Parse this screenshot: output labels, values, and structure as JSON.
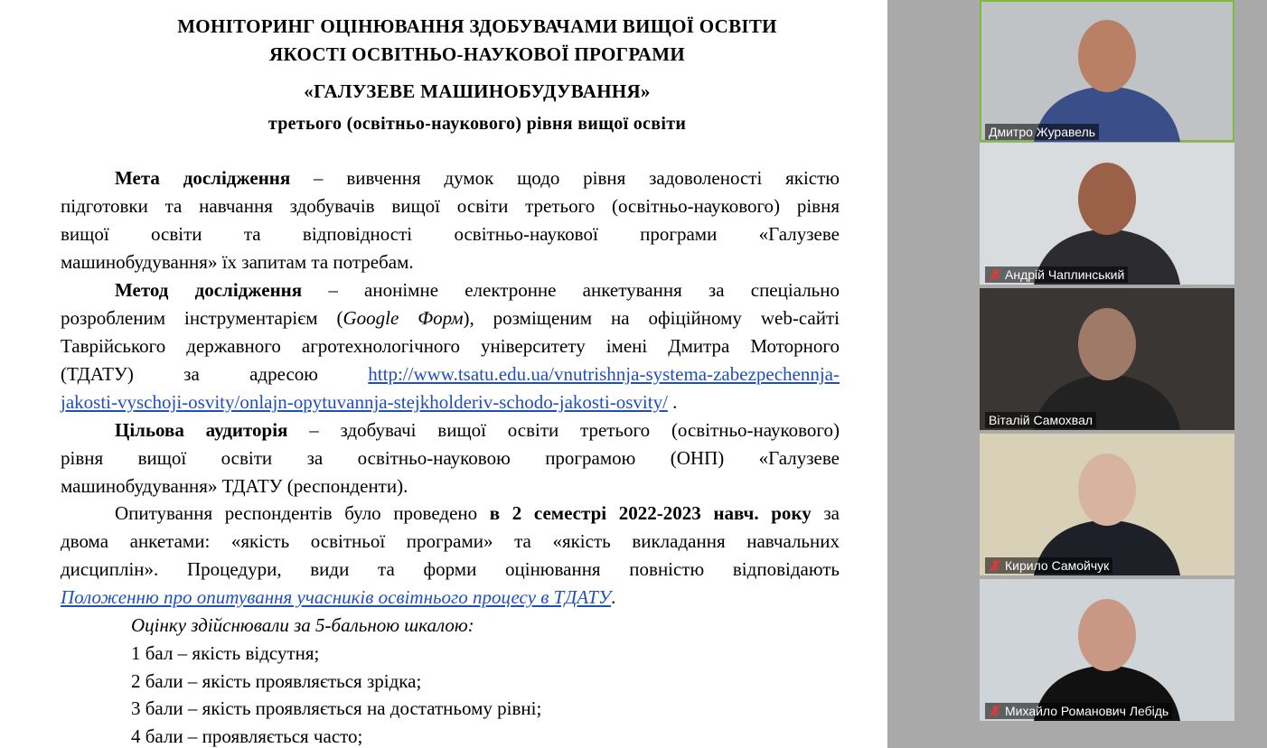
{
  "document": {
    "title_lines": [
      "МОНІТОРИНГ ОЦІНЮВАННЯ ЗДОБУВАЧАМИ ВИЩОЇ ОСВІТИ",
      "ЯКОСТІ ОСВІТНЬО-НАУКОВОЇ ПРОГРАМИ",
      "«ГАЛУЗЕВЕ МАШИНОБУДУВАННЯ»",
      "третього (освітньо-наукового)  рівня  вищої освіти"
    ],
    "goal": {
      "label": "Мета дослідження",
      "l1": " – вивчення думок щодо рівня задоволеності якістю",
      "l2": "підготовки та навчання здобувачів вищої освіти третього (освітньо-наукового) рівня",
      "l3": "вищої освіти та відповідності освітньо-наукової програми «Галузеве",
      "l4": "машинобудування» їх запитам та потребам."
    },
    "method": {
      "label": "Метод дослідження",
      "l1": " – анонімне електронне анкетування за спеціально",
      "l2a": "розробленим інструментарієм (",
      "l2b": "Google Форм",
      "l2c": "), розміщеним на офіційному web-сайті",
      "l3": "Таврійського державного агротехнологічного університету імені Дмитра Моторного",
      "l4a": "(ТДАТУ) за адресою ",
      "link1": "http://www.tsatu.edu.ua/vnutrishnja-systema-zabezpechennja-",
      "link2": "jakosti-vyschoji-osvity/onlajn-opytuvannja-stejkholderiv-schodo-jakosti-osvity/",
      "l5end": " ."
    },
    "audience": {
      "label": "Цільова аудиторія",
      "l1": " – здобувачі вищої освіти третього (освітньо-наукового)",
      "l2": "рівня вищої освіти за  освітньо-науковою програмою (ОНП) «Галузеве",
      "l3": "машинобудування» ТДАТУ (респонденти)."
    },
    "survey": {
      "l1a": "Опитування респондентів було проведено ",
      "l1b": "в 2 семестрі 2022-2023 навч. року",
      "l1c": " за",
      "l2": "двома анкетами: «якість освітньої програми» та «якість викладання навчальних",
      "l3": "дисциплін». Процедури, види та форми оцінювання повністю відповідають",
      "link": "Положенню про опитування учасників освітнього процесу в ТДАТУ",
      "end": "."
    },
    "scale_intro": "Оцінку здійснювали за 5-бальною шкалою:",
    "scale": [
      "1 бал – якість відсутня;",
      "2 бали – якість проявляється зрідка;",
      "3 бали – якість проявляється на достатньому рівні;",
      "4 бали – проявляється часто;"
    ]
  },
  "participants": [
    {
      "name": "Дмитро Журавель",
      "muted": false,
      "active": true,
      "bg": "#bfc3c5",
      "skin": "#b98066",
      "shirt": "#3a4f8a"
    },
    {
      "name": "Андрій Чаплинський",
      "muted": true,
      "active": false,
      "bg": "#d9dcdf",
      "skin": "#9a6048",
      "shirt": "#2b2b30"
    },
    {
      "name": "Віталій Самохвал",
      "muted": false,
      "active": false,
      "bg": "#3a3633",
      "skin": "#a07a68",
      "shirt": "#222222"
    },
    {
      "name": "Кирило Самойчук",
      "muted": true,
      "active": false,
      "bg": "#d9d0b8",
      "skin": "#d6b4a0",
      "shirt": "#1e2028"
    },
    {
      "name": "Михайло Романович Лебідь",
      "muted": true,
      "active": false,
      "bg": "#cfd4d8",
      "skin": "#c99884",
      "shirt": "#111111"
    }
  ],
  "colors": {
    "link": "#1f4fbf",
    "active_border": "#7dbb3c",
    "muted_icon": "#e53935"
  }
}
